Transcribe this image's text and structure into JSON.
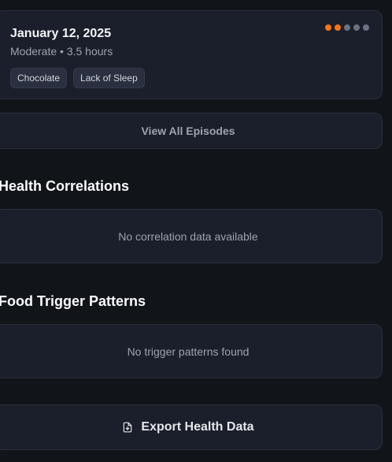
{
  "episode": {
    "date": "January 12, 2025",
    "meta": "Moderate • 3.5 hours",
    "severity": 2,
    "severity_max": 5,
    "severity_active_color": "#f97316",
    "severity_inactive_color": "#6b7280",
    "tags": [
      "Chocolate",
      "Lack of Sleep"
    ]
  },
  "view_all_label": "View All Episodes",
  "health": {
    "title": "Health Correlations",
    "empty_text": "No correlation data available"
  },
  "food": {
    "title": "Food Trigger Patterns",
    "empty_text": "No trigger patterns found"
  },
  "export": {
    "label": "Export Health Data",
    "icon": "file-download-icon"
  }
}
